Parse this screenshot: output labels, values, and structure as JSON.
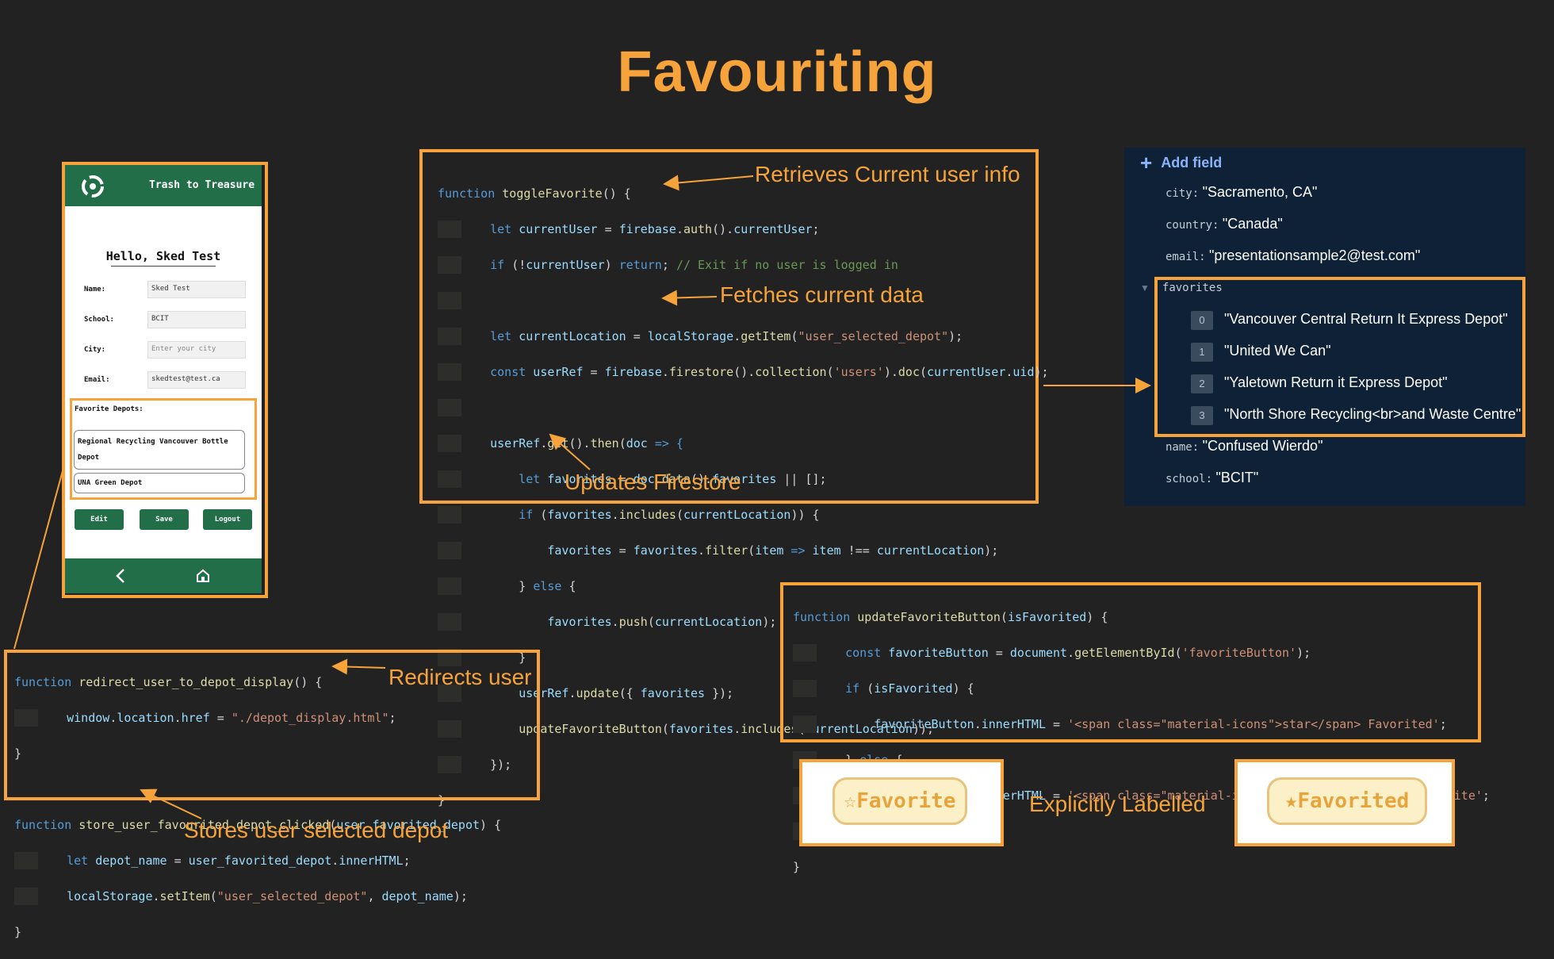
{
  "slide": {
    "title": "Favouriting",
    "accent_color": "#f5a33a",
    "background_color": "#222222"
  },
  "annotations": {
    "retrieves": "Retrieves Current user info",
    "fetches": "Fetches current data",
    "updates": "Updates Firestore",
    "redirects": "Redirects user",
    "stores": "Stores user selected depot",
    "explicit": "Explicitly Labelled"
  },
  "phone": {
    "app_title": "Trash to Treasure",
    "logo_icon": "recycle-icon",
    "greeting": "Hello, Sked Test",
    "fields": [
      {
        "label": "Name:",
        "value": "Sked Test"
      },
      {
        "label": "School:",
        "value": "BCIT"
      },
      {
        "label": "City:",
        "value": "",
        "placeholder": "Enter your city"
      },
      {
        "label": "Email:",
        "value": "skedtest@test.ca"
      }
    ],
    "favorites_heading": "Favorite Depots:",
    "favorites": [
      "Regional Recycling Vancouver Bottle Depot",
      "UNA Green Depot"
    ],
    "buttons": {
      "edit": "Edit",
      "save": "Save",
      "logout": "Logout"
    },
    "nav_icons": [
      "back-arrow-icon",
      "home-icon"
    ]
  },
  "firestore": {
    "add_field": "Add field",
    "fields": {
      "city": {
        "key": "city:",
        "value": "\"Sacramento, CA\""
      },
      "country": {
        "key": "country:",
        "value": "\"Canada\""
      },
      "email": {
        "key": "email:",
        "value": "\"presentationsample2@test.com\""
      },
      "favorites_key": "favorites",
      "favorites": [
        {
          "index": "0",
          "value": "\"Vancouver Central Return It Express Depot\""
        },
        {
          "index": "1",
          "value": "\"United We Can\""
        },
        {
          "index": "2",
          "value": "\"Yaletown Return it Express Depot\""
        },
        {
          "index": "3",
          "value": "\"North Shore Recycling<br>and Waste Centre\""
        }
      ],
      "name": {
        "key": "name:",
        "value": "\"Confused Wierdo\""
      },
      "school": {
        "key": "school:",
        "value": "\"BCIT\""
      }
    }
  },
  "code_toggle": {
    "l1a": "function",
    "l1b": " toggleFavorite",
    "l1c": "() {",
    "l2a": "let",
    "l2b": " currentUser",
    "l2c": " = ",
    "l2d": "firebase",
    "l2e": ".",
    "l2f": "auth",
    "l2g": "().",
    "l2h": "currentUser",
    "l2i": ";",
    "l3a": "if",
    "l3b": " (!",
    "l3c": "currentUser",
    "l3d": ") ",
    "l3e": "return",
    "l3f": "; ",
    "l3g": "// Exit if no user is logged in",
    "l5a": "let",
    "l5b": " currentLocation",
    "l5c": " = ",
    "l5d": "localStorage",
    "l5e": ".",
    "l5f": "getItem",
    "l5g": "(",
    "l5h": "\"user_selected_depot\"",
    "l5i": ");",
    "l6a": "const",
    "l6b": " userRef",
    "l6c": " = ",
    "l6d": "firebase",
    "l6e": ".",
    "l6f": "firestore",
    "l6g": "().",
    "l6h": "collection",
    "l6i": "(",
    "l6j": "'users'",
    "l6k": ").",
    "l6l": "doc",
    "l6m": "(",
    "l6n": "currentUser",
    "l6o": ".",
    "l6p": "uid",
    "l6q": ");",
    "l8a": "userRef",
    "l8b": ".",
    "l8c": "get",
    "l8d": "().",
    "l8e": "then",
    "l8f": "(",
    "l8g": "doc",
    "l8h": " => {",
    "l9a": "let",
    "l9b": " favorites",
    "l9c": " = ",
    "l9d": "doc",
    "l9e": ".",
    "l9f": "data",
    "l9g": "().",
    "l9h": "favorites",
    "l9i": " || [];",
    "l10a": "if",
    "l10b": " (",
    "l10c": "favorites",
    "l10d": ".",
    "l10e": "includes",
    "l10f": "(",
    "l10g": "currentLocation",
    "l10h": ")) {",
    "l11a": "favorites",
    "l11b": " = ",
    "l11c": "favorites",
    "l11d": ".",
    "l11e": "filter",
    "l11f": "(",
    "l11g": "item",
    "l11h": " => ",
    "l11i": "item",
    "l11j": " !== ",
    "l11k": "currentLocation",
    "l11l": ");",
    "l12a": "} ",
    "l12b": "else",
    "l12c": " {",
    "l13a": "favorites",
    "l13b": ".",
    "l13c": "push",
    "l13d": "(",
    "l13e": "currentLocation",
    "l13f": ");",
    "l14": "}",
    "l15a": "userRef",
    "l15b": ".",
    "l15c": "update",
    "l15d": "({ ",
    "l15e": "favorites",
    "l15f": " });",
    "l16a": "updateFavoriteButton",
    "l16b": "(",
    "l16c": "favorites",
    "l16d": ".",
    "l16e": "includes",
    "l16f": "(",
    "l16g": "currentLocation",
    "l16h": "));",
    "l17": "});",
    "l18": "}"
  },
  "code_redirect": {
    "l1a": "function",
    "l1b": " redirect_user_to_depot_display",
    "l1c": "() {",
    "l2a": "window",
    "l2b": ".",
    "l2c": "location",
    "l2d": ".",
    "l2e": "href",
    "l2f": " = ",
    "l2g": "\"./depot_display.html\"",
    "l2h": ";",
    "l3": "}",
    "l5a": "function",
    "l5b": " store_user_favourited_depot_clicked",
    "l5c": "(",
    "l5d": "user_favorited_depot",
    "l5e": ") {",
    "l6a": "let",
    "l6b": " depot_name",
    "l6c": " = ",
    "l6d": "user_favorited_depot",
    "l6e": ".",
    "l6f": "innerHTML",
    "l6g": ";",
    "l7a": "localStorage",
    "l7b": ".",
    "l7c": "setItem",
    "l7d": "(",
    "l7e": "\"user_selected_depot\"",
    "l7f": ", ",
    "l7g": "depot_name",
    "l7h": ");",
    "l8": "}"
  },
  "code_update": {
    "l1a": "function",
    "l1b": " updateFavoriteButton",
    "l1c": "(",
    "l1d": "isFavorited",
    "l1e": ") {",
    "l2a": "const",
    "l2b": " favoriteButton",
    "l2c": " = ",
    "l2d": "document",
    "l2e": ".",
    "l2f": "getElementById",
    "l2g": "(",
    "l2h": "'favoriteButton'",
    "l2i": ");",
    "l3a": "if",
    "l3b": " (",
    "l3c": "isFavorited",
    "l3d": ") {",
    "l4a": "favoriteButton",
    "l4b": ".",
    "l4c": "innerHTML",
    "l4d": " = ",
    "l4e": "'<span class=\"material-icons\">star</span> Favorited'",
    "l4f": ";",
    "l5a": "} ",
    "l5b": "else",
    "l5c": " {",
    "l6a": "favoriteButton",
    "l6b": ".",
    "l6c": "innerHTML",
    "l6d": " = ",
    "l6e": "'<span class=\"material-icons\">star_border</span> Favorite'",
    "l6f": ";",
    "l7": "}",
    "l8": "}"
  },
  "buttons_demo": {
    "favorite_label": "Favorite",
    "favorite_icon": "star-outline-icon",
    "favorited_label": "Favorited",
    "favorited_icon": "star-filled-icon"
  }
}
